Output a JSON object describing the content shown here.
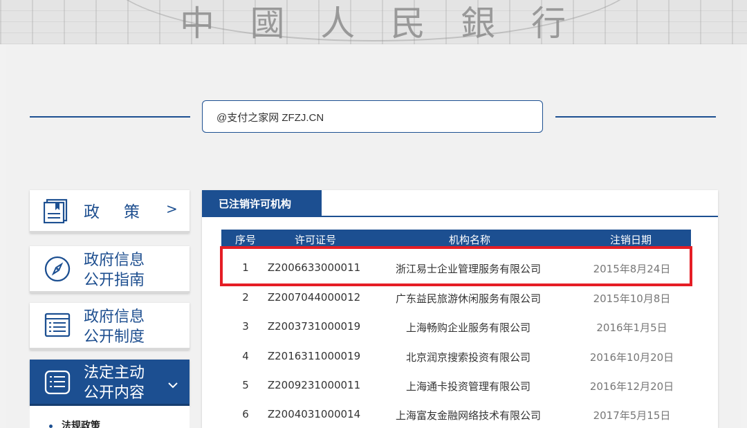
{
  "banner": {
    "characters": [
      "中",
      "國",
      "人",
      "民",
      "銀",
      "行"
    ]
  },
  "search": {
    "value": "@支付之家网 ZFZJ.CN",
    "placeholder": "",
    "icon": "search-icon"
  },
  "sidebar": {
    "items": [
      {
        "label": "政　策",
        "icon": "book-icon",
        "chevron": ">"
      },
      {
        "label_line1": "政府信息",
        "label_line2": "公开指南",
        "icon": "compass-icon"
      },
      {
        "label_line1": "政府信息",
        "label_line2": "公开制度",
        "icon": "document-list-icon"
      },
      {
        "label_line1": "法定主动",
        "label_line2": "公开内容",
        "icon": "document-list-icon",
        "chevron": "⌄",
        "active": true
      }
    ],
    "sub_items": [
      {
        "label": "法规政策"
      }
    ]
  },
  "panel": {
    "tab_label": "已注销许可机构",
    "columns": [
      "序号",
      "许可证号",
      "机构名称",
      "注销日期"
    ],
    "rows": [
      {
        "no": "1",
        "license": "Z2006633000011",
        "name": "浙江易士企业管理服务有限公司",
        "date": "2015年8月24日",
        "highlighted": true
      },
      {
        "no": "2",
        "license": "Z2007044000012",
        "name": "广东益民旅游休闲服务有限公司",
        "date": "2015年10月8日"
      },
      {
        "no": "3",
        "license": "Z2003731000019",
        "name": "上海畅购企业服务有限公司",
        "date": "2016年1月5日"
      },
      {
        "no": "4",
        "license": "Z2016311000019",
        "name": "北京润京搜索投资有限公司",
        "date": "2016年10月20日"
      },
      {
        "no": "5",
        "license": "Z2009231000011",
        "name": "上海通卡投资管理有限公司",
        "date": "2016年12月20日"
      },
      {
        "no": "6",
        "license": "Z2004031000014",
        "name": "上海富友金融网络技术有限公司",
        "date": "2017年5月15日"
      }
    ]
  },
  "colors": {
    "primary": "#1c4f91",
    "highlight": "#e51d25"
  }
}
